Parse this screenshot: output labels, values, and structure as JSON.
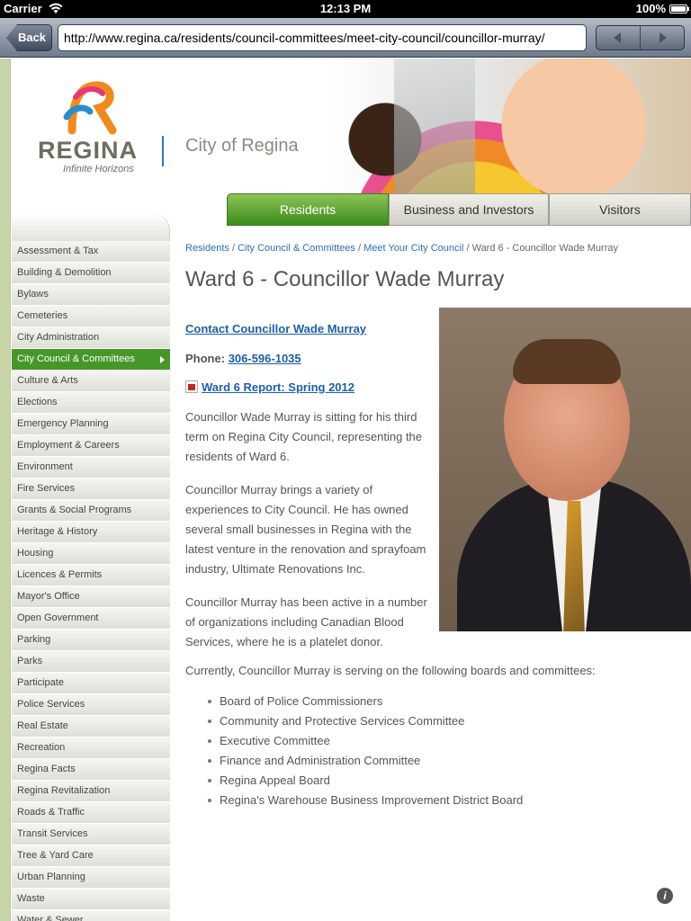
{
  "status_bar": {
    "carrier": "Carrier",
    "time": "12:13 PM",
    "battery": "100%"
  },
  "toolbar": {
    "back_label": "Back",
    "url": "http://www.regina.ca/residents/council-committees/meet-city-council/councillor-murray/"
  },
  "header": {
    "logo_word": "REGINA",
    "logo_tagline": "Infinite Horizons",
    "city_name": "City of Regina"
  },
  "tabs": [
    {
      "label": "Residents",
      "active": true
    },
    {
      "label": "Business and Investors",
      "active": false
    },
    {
      "label": "Visitors",
      "active": false
    }
  ],
  "sidebar": {
    "items": [
      {
        "label": "Assessment & Tax"
      },
      {
        "label": "Building & Demolition"
      },
      {
        "label": "Bylaws"
      },
      {
        "label": "Cemeteries"
      },
      {
        "label": "City Administration"
      },
      {
        "label": "City Council & Committees",
        "active": true
      },
      {
        "label": "Culture & Arts"
      },
      {
        "label": "Elections"
      },
      {
        "label": "Emergency Planning"
      },
      {
        "label": "Employment & Careers"
      },
      {
        "label": "Environment"
      },
      {
        "label": "Fire Services"
      },
      {
        "label": "Grants & Social Programs"
      },
      {
        "label": "Heritage & History"
      },
      {
        "label": "Housing"
      },
      {
        "label": "Licences & Permits"
      },
      {
        "label": "Mayor's Office"
      },
      {
        "label": "Open Government"
      },
      {
        "label": "Parking"
      },
      {
        "label": "Parks"
      },
      {
        "label": "Participate"
      },
      {
        "label": "Police Services"
      },
      {
        "label": "Real Estate"
      },
      {
        "label": "Recreation"
      },
      {
        "label": "Regina Facts"
      },
      {
        "label": "Regina Revitalization"
      },
      {
        "label": "Roads & Traffic"
      },
      {
        "label": "Transit Services"
      },
      {
        "label": "Tree & Yard Care"
      },
      {
        "label": "Urban Planning"
      },
      {
        "label": "Waste"
      },
      {
        "label": "Water & Sewer"
      }
    ]
  },
  "breadcrumb": {
    "items": [
      "Residents",
      "City Council & Committees",
      "Meet Your City Council"
    ],
    "current": "Ward 6 - Councillor Wade Murray",
    "separator": "/"
  },
  "main": {
    "title": "Ward 6 - Councillor Wade Murray",
    "contact_link": "Contact Councillor Wade Murray",
    "phone_label": "Phone:",
    "phone_number": "306-596-1035",
    "report_link": "Ward 6 Report: Spring 2012",
    "paragraphs": [
      "Councillor Wade Murray is sitting for his third term on Regina City Council, representing the residents of Ward 6.",
      "Councillor Murray brings a variety of experiences to City Council. He has owned several small businesses in Regina with the latest venture in the renovation and sprayfoam industry, Ultimate Renovations Inc.",
      "Councillor Murray has been active in a number of organizations including Canadian Blood Services, where he is a platelet donor."
    ],
    "committees_intro": "Currently, Councillor Murray is serving on the following boards and committees:",
    "committees": [
      "Board of Police Commissioners",
      "Community and Protective Services Committee",
      "Executive Committee",
      "Finance and Administration Committee",
      "Regina Appeal Board",
      "Regina's Warehouse Business Improvement District Board"
    ]
  },
  "colors": {
    "link": "#1d5fa8",
    "active_green": "#47962a",
    "title_gray": "#555555"
  }
}
